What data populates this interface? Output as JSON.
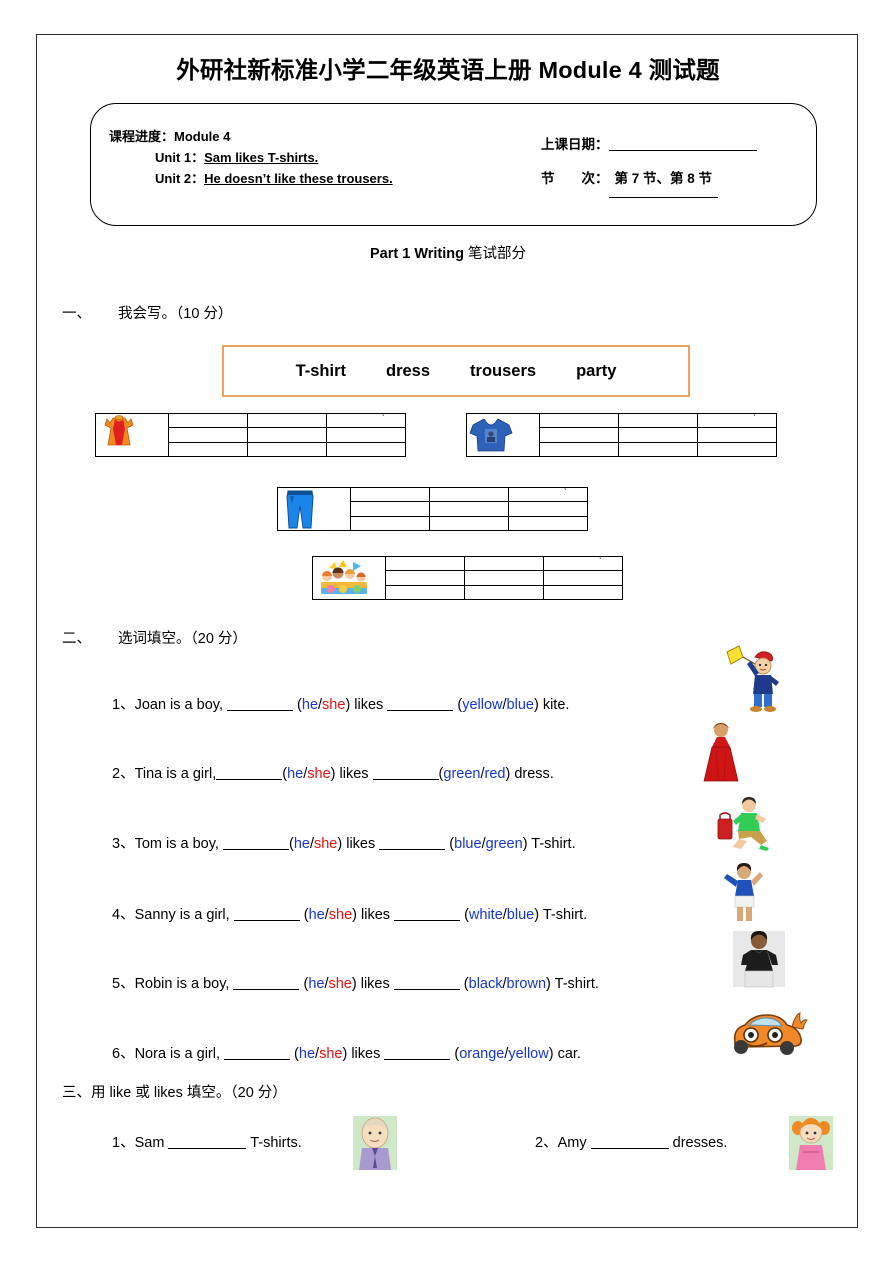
{
  "document": {
    "title_cn_lead": "外研社新标准小学二年级英语上册 ",
    "title_module": "Module 4",
    "title_cn_tail": " 测试题"
  },
  "info_box": {
    "progress_label": "课程进度：",
    "progress_value": "Module 4",
    "unit1_label": "Unit 1：",
    "unit1_value": "Sam likes T-shirts.",
    "unit2_label": "Unit 2：",
    "unit2_value": "He doesn’t like these trousers.",
    "date_label": "上课日期：",
    "date_value": "",
    "period_label": "节　　次：",
    "period_value": "第 7 节、第 8 节"
  },
  "part_heading": {
    "en": "Part 1 Writing",
    "cn": " 笔试部分"
  },
  "section1": {
    "number": "一、",
    "title": "我会写。（10 分）",
    "word_bank": [
      "T-shirt",
      "dress",
      "trousers",
      "party"
    ],
    "tables": [
      {
        "name": "dress-table",
        "icon": "dress-icon",
        "tick": "ˋ"
      },
      {
        "name": "tshirt-table",
        "icon": "tshirt-icon",
        "tick": "ˋ"
      },
      {
        "name": "trousers-table",
        "icon": "trousers-icon",
        "tick": "ˋ"
      },
      {
        "name": "party-table",
        "icon": "party-icon",
        "tick": "ˋ"
      }
    ]
  },
  "section2": {
    "number": "二、",
    "title": "选词填空。（20 分）",
    "items": [
      {
        "num": "1、",
        "subject": "Joan is a boy,",
        "verb": "likes",
        "opt_a": "he",
        "opt_b": "she",
        "col_a": "yellow",
        "col_b": "blue",
        "noun": "kite.",
        "tight_after_blank1": false,
        "tight_after_blank2": false,
        "illustration": "boy-flying-kite-image"
      },
      {
        "num": "2、",
        "subject": "Tina is a girl,",
        "verb": "likes",
        "opt_a": "he",
        "opt_b": "she",
        "col_a": "green",
        "col_b": "red",
        "noun": "dress.",
        "tight_after_blank1": true,
        "tight_after_blank2": true,
        "illustration": "girl-red-dress-image"
      },
      {
        "num": "3、",
        "subject": "Tom is a boy,",
        "verb": "likes",
        "opt_a": "he",
        "opt_b": "she",
        "col_a": "blue",
        "col_b": "green",
        "noun": "T-shirt.",
        "tight_after_blank1": true,
        "tight_after_blank2": false,
        "illustration": "boy-green-tshirt-image"
      },
      {
        "num": "4、",
        "subject": "Sanny is a girl,",
        "verb": "likes",
        "opt_a": "he",
        "opt_b": "she",
        "col_a": "white",
        "col_b": "blue",
        "noun": "T-shirt.",
        "tight_after_blank1": false,
        "tight_after_blank2": false,
        "illustration": "girl-blue-tshirt-image"
      },
      {
        "num": "5、",
        "subject": "Robin is a boy,",
        "verb": "likes",
        "opt_a": "he",
        "opt_b": "she",
        "col_a": "black",
        "col_b": "brown",
        "noun": "T-shirt.",
        "tight_after_blank1": false,
        "tight_after_blank2": false,
        "illustration": "man-black-tshirt-image"
      },
      {
        "num": "6、",
        "subject": "Nora is a girl,",
        "verb": "likes",
        "opt_a": "he",
        "opt_b": "she",
        "col_a": "orange",
        "col_b": "yellow",
        "noun": "car.",
        "tight_after_blank1": false,
        "tight_after_blank2": false,
        "illustration": "orange-car-image"
      }
    ]
  },
  "section3": {
    "number": "三、",
    "title": "用 like 或 likes 填空。（20 分）",
    "items": [
      {
        "num": "1、",
        "subject": "Sam",
        "object": "T-shirts.",
        "illustration": "sam-character-image"
      },
      {
        "num": "2、",
        "subject": "Amy",
        "object": "dresses.",
        "illustration": "amy-character-image"
      }
    ]
  },
  "colors": {
    "option_blue": "#1736CF",
    "option_red": "#E8110E",
    "word_bank_border": "#E9A45F",
    "page_border": "#2B2B2B"
  }
}
